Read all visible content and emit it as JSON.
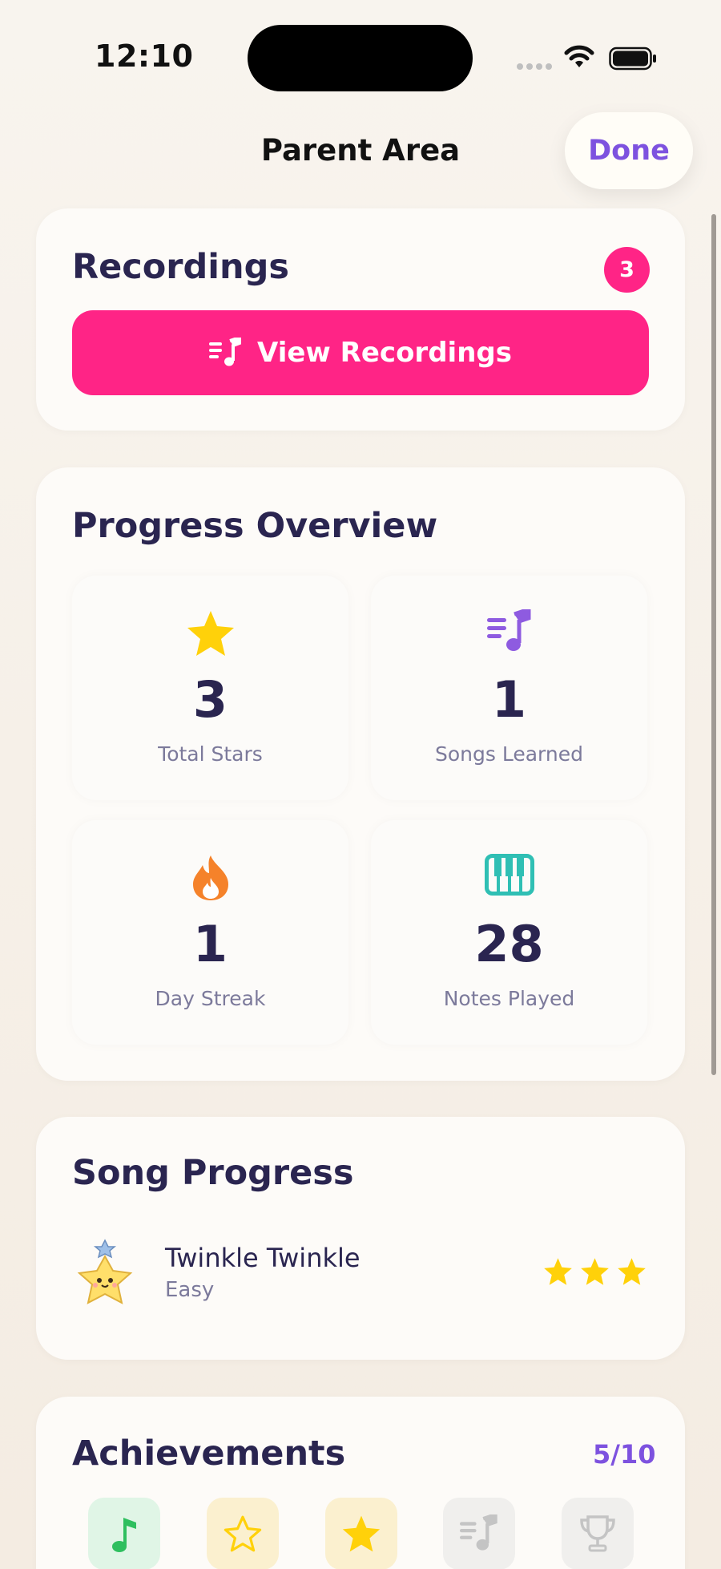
{
  "status_bar": {
    "time": "12:10"
  },
  "nav": {
    "title": "Parent Area",
    "done_label": "Done"
  },
  "recordings": {
    "title": "Recordings",
    "count": "3",
    "button_label": "View Recordings"
  },
  "progress": {
    "title": "Progress Overview",
    "stats": [
      {
        "value": "3",
        "label": "Total Stars",
        "icon": "star-icon",
        "color": "#ffd10a"
      },
      {
        "value": "1",
        "label": "Songs Learned",
        "icon": "music-list-icon",
        "color": "#8e5be0"
      },
      {
        "value": "1",
        "label": "Day Streak",
        "icon": "flame-icon",
        "color": "#f5822a"
      },
      {
        "value": "28",
        "label": "Notes Played",
        "icon": "piano-icon",
        "color": "#2fbfb4"
      }
    ]
  },
  "song_progress": {
    "title": "Song Progress",
    "songs": [
      {
        "name": "Twinkle Twinkle",
        "difficulty": "Easy",
        "stars": 3,
        "max_stars": 3
      }
    ]
  },
  "achievements": {
    "title": "Achievements",
    "count": "5/10",
    "badges": [
      {
        "icon": "music-note-icon",
        "unlocked": true,
        "color": "#2fbf5f"
      },
      {
        "icon": "star-outline-icon",
        "unlocked": true,
        "color": "#ffd10a"
      },
      {
        "icon": "star-icon",
        "unlocked": true,
        "color": "#ffd10a"
      },
      {
        "icon": "music-list-icon",
        "unlocked": false,
        "color": "#c4c4c4"
      },
      {
        "icon": "trophy-icon",
        "unlocked": false,
        "color": "#c4c4c4"
      }
    ]
  },
  "colors": {
    "accent": "#ff2486",
    "purple": "#7d52df",
    "navy": "#2a2550"
  }
}
